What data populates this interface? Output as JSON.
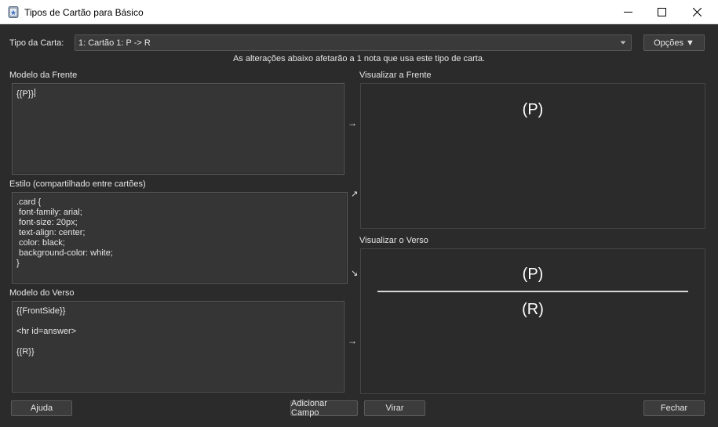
{
  "window": {
    "title": "Tipos de Cartão para Básico"
  },
  "header": {
    "card_type_label": "Tipo da Carta:",
    "card_type_value": "1: Cartão 1: P -> R",
    "options_button": "Opções ▼",
    "notice": "As alterações abaixo afetarão a 1 nota que usa este tipo de carta."
  },
  "front_template": {
    "label": "Modelo da Frente",
    "content": "{{P}}"
  },
  "styling": {
    "label": "Estilo (compartilhado entre cartões)",
    "content": ".card {\n font-family: arial;\n font-size: 20px;\n text-align: center;\n color: black;\n background-color: white;\n}"
  },
  "back_template": {
    "label": "Modelo do Verso",
    "content": "{{FrontSide}}\n\n<hr id=answer>\n\n{{R}}"
  },
  "front_preview": {
    "label": "Visualizar a Frente",
    "question": "(P)"
  },
  "back_preview": {
    "label": "Visualizar o Verso",
    "question": "(P)",
    "answer": "(R)"
  },
  "footer": {
    "help_button": "Ajuda",
    "add_field_button": "Adicionar Campo",
    "flip_button": "Virar",
    "close_button": "Fechar"
  },
  "arrows": {
    "right": "→",
    "up_right": "↗",
    "down_right": "↘"
  }
}
